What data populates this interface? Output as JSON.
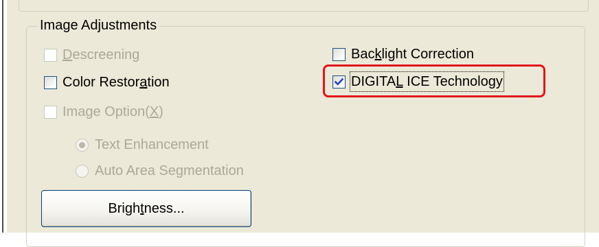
{
  "group": {
    "title": "Image Adjustments"
  },
  "checkboxes": {
    "descreening": {
      "pre": "",
      "mnemonic": "D",
      "post": "escreening",
      "checked": false,
      "enabled": false
    },
    "color_restoration": {
      "pre": "Color Restor",
      "mnemonic": "a",
      "post": "tion",
      "checked": false,
      "enabled": true
    },
    "image_option": {
      "pre": "Image Option(",
      "mnemonic": "X",
      "post": ")",
      "checked": false,
      "enabled": false
    },
    "backlight_correction": {
      "pre": "Bac",
      "mnemonic": "k",
      "post": "light Correction",
      "checked": false,
      "enabled": true
    },
    "digital_ice": {
      "pre": "DIGITA",
      "mnemonic": "L",
      "post": " ICE Technology",
      "checked": true,
      "enabled": true
    }
  },
  "radios": {
    "text_enhancement": {
      "label": "Text Enhancement",
      "selected": true,
      "enabled": false
    },
    "auto_area_segmentation": {
      "label": "Auto Area Segmentation",
      "selected": false,
      "enabled": false
    }
  },
  "buttons": {
    "brightness": {
      "pre": "Brigh",
      "mnemonic": "t",
      "post": "ness..."
    }
  },
  "colors": {
    "highlight": "#e3131a",
    "check_mark": "#2147c8",
    "disabled_text": "#aca899"
  }
}
